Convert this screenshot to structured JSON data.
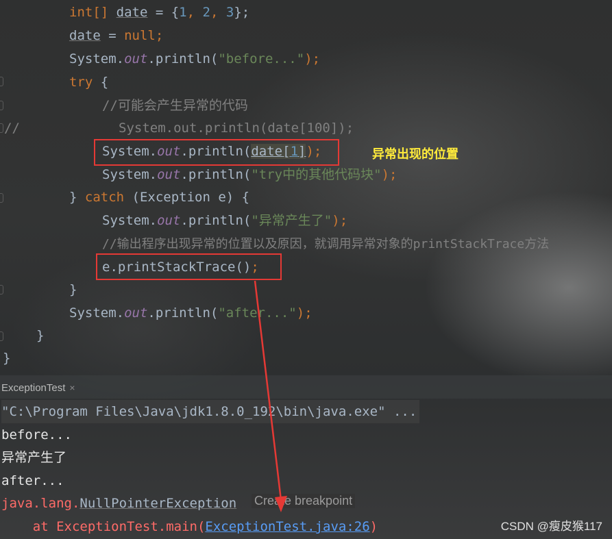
{
  "code": {
    "l1": {
      "t1": "int[] ",
      "t2": "date",
      "t3": " = {",
      "n1": "1",
      "c1": ", ",
      "n2": "2",
      "c2": ", ",
      "n3": "3",
      "t4": "};"
    },
    "l2": {
      "t1": "date",
      "t2": " = ",
      "t3": "null",
      "t4": ";"
    },
    "l3": {
      "t1": "System.",
      "t2": "out",
      "t3": ".println(",
      "t4": "\"before...\"",
      "t5": ");"
    },
    "l4": {
      "t1": "try",
      "t2": " {"
    },
    "l5": {
      "t1": "//可能会产生异常的代码"
    },
    "l6": {
      "t1": "//",
      "t2": "System.out.println(date[100]);"
    },
    "l7": {
      "t1": "System.",
      "t2": "out",
      "t3": ".println(",
      "t4": "date",
      "t5": "[",
      "t6": "1",
      "t7": "]",
      "t8": ");"
    },
    "l8": {
      "t1": "System.",
      "t2": "out",
      "t3": ".println(",
      "t4": "\"try中的其他代码块\"",
      "t5": ");"
    },
    "l9": {
      "t1": "} ",
      "t2": "catch",
      "t3": " (Exception e) {"
    },
    "l10": {
      "t1": "System.",
      "t2": "out",
      "t3": ".println(",
      "t4": "\"异常产生了\"",
      "t5": ");"
    },
    "l11": {
      "t1": "//输出程序出现异常的位置以及原因，就调用异常对象的printStackTrace方法"
    },
    "l12": {
      "t1": "e.printStackTrace()",
      "t2": ";"
    },
    "l13": {
      "t1": "}"
    },
    "l14": {
      "t1": "System.",
      "t2": "out",
      "t3": ".println(",
      "t4": "\"after...\"",
      "t5": ");"
    },
    "l15": {
      "t1": "}"
    },
    "l16": {
      "t1": "}"
    }
  },
  "annotation": "异常出现的位置",
  "run_tab": {
    "label": "ExceptionTest",
    "close": "×"
  },
  "console": {
    "cmd": "\"C:\\Program Files\\Java\\jdk1.8.0_192\\bin\\java.exe\" ...",
    "out1": "before...",
    "out2": "异常产生了",
    "out3": "after...",
    "exc_prefix": "java.lang.",
    "exc_name": "NullPointerException",
    "tooltip": "Create breakpoint",
    "trace_prefix": "    at ExceptionTest.main(",
    "trace_link": "ExceptionTest.java:26",
    "trace_suffix": ")"
  },
  "watermark": "CSDN @瘦皮猴117"
}
